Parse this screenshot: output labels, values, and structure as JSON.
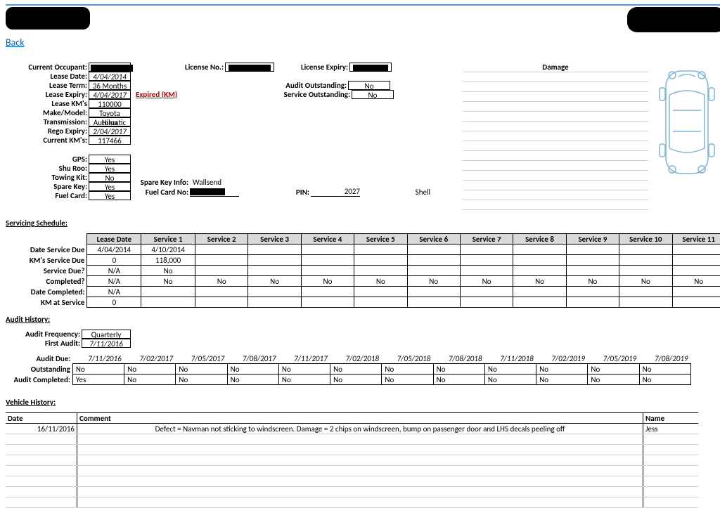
{
  "nav": {
    "back": "Back"
  },
  "headings": {
    "damage": "Damage",
    "servicing_schedule": "Servicing Schedule:",
    "audit_history": "Audit History:",
    "vehicle_history": "Vehicle History:"
  },
  "labels": {
    "current_occupant": "Current Occupant:",
    "lease_date": "Lease Date:",
    "lease_term": "Lease Term:",
    "lease_expiry": "Lease Expiry:",
    "lease_kms": "Lease KM's",
    "make_model": "Make/Model:",
    "transmission": "Transmission:",
    "rego_expiry": "Rego Expiry:",
    "current_kms": "Current KM's:",
    "gps": "GPS:",
    "shu_roo": "Shu Roo:",
    "towing_kit": "Towing Kit:",
    "spare_key": "Spare Key:",
    "fuel_card": "Fuel Card:",
    "license_no": "License No.:",
    "license_expiry": "License Expiry:",
    "audit_outstanding": "Audit Outstanding:",
    "service_outstanding": "Service Outstanding:",
    "spare_key_info": "Spare Key Info:",
    "fuel_card_no": "Fuel Card No:",
    "pin": "PIN:",
    "audit_frequency": "Audit Frequency:",
    "first_audit": "First Audit:",
    "audit_due": "Audit Due:",
    "outstanding": "Outstanding",
    "audit_completed": "Audit Completed:",
    "date": "Date",
    "comment": "Comment",
    "name": "Name"
  },
  "vehicle": {
    "lease_date": "4/04/2014",
    "lease_term": "36 Months",
    "lease_expiry": "4/04/2017",
    "expired_note": "Expired (KM)",
    "lease_kms": "110000",
    "make_model": "Toyota Hilux",
    "transmission": "Automatic",
    "rego_expiry": "2/04/2017",
    "current_kms": "117466",
    "gps": "Yes",
    "shu_roo": "Yes",
    "towing_kit": "No",
    "spare_key": "Yes",
    "fuel_card": "Yes",
    "audit_outstanding": "No",
    "service_outstanding": "No",
    "spare_key_info": "Wallsend",
    "pin": "2027",
    "fuel_provider": "Shell"
  },
  "servicing": {
    "headers": [
      "Lease Date",
      "Service 1",
      "Service 2",
      "Service 3",
      "Service 4",
      "Service 5",
      "Service 6",
      "Service 7",
      "Service 8",
      "Service 9",
      "Service 10",
      "Service 11"
    ],
    "row_labels": {
      "date_service_due": "Date Service Due",
      "kms_service_due": "KM's Service Due",
      "service_due": "Service Due?",
      "completed": "Completed?",
      "date_completed": "Date Completed:",
      "km_at_service": "KM at Service"
    },
    "rows": {
      "date_service_due": [
        "4/04/2014",
        "4/10/2014",
        "",
        "",
        "",
        "",
        "",
        "",
        "",
        "",
        "",
        ""
      ],
      "kms_service_due": [
        "0",
        "118,000",
        "",
        "",
        "",
        "",
        "",
        "",
        "",
        "",
        "",
        ""
      ],
      "service_due": [
        "N/A",
        "No",
        "",
        "",
        "",
        "",
        "",
        "",
        "",
        "",
        "",
        ""
      ],
      "completed": [
        "N/A",
        "No",
        "No",
        "No",
        "No",
        "No",
        "No",
        "No",
        "No",
        "No",
        "No",
        "No"
      ],
      "date_completed": [
        "N/A",
        "",
        "",
        "",
        "",
        "",
        "",
        "",
        "",
        "",
        "",
        ""
      ],
      "km_at_service": [
        "0",
        "",
        "",
        "",
        "",
        "",
        "",
        "",
        "",
        "",
        "",
        ""
      ]
    }
  },
  "audit": {
    "frequency": "Quarterly",
    "first_audit": "7/11/2016",
    "dates": [
      "7/11/2016",
      "7/02/2017",
      "7/05/2017",
      "7/08/2017",
      "7/11/2017",
      "7/02/2018",
      "7/05/2018",
      "7/08/2018",
      "7/11/2018",
      "7/02/2019",
      "7/05/2019",
      "7/08/2019"
    ],
    "outstanding": [
      "No",
      "No",
      "No",
      "No",
      "No",
      "No",
      "No",
      "No",
      "No",
      "No",
      "No",
      "No"
    ],
    "completed": [
      "Yes",
      "No",
      "No",
      "No",
      "No",
      "No",
      "No",
      "No",
      "No",
      "No",
      "No",
      "No"
    ]
  },
  "history": [
    {
      "date": "16/11/2016",
      "comment": "Defect = Navman not sticking to windscreen. Damage = 2 chips on windscreen, bump on passenger door and LHS decals peeling off",
      "name": "Jess"
    }
  ]
}
